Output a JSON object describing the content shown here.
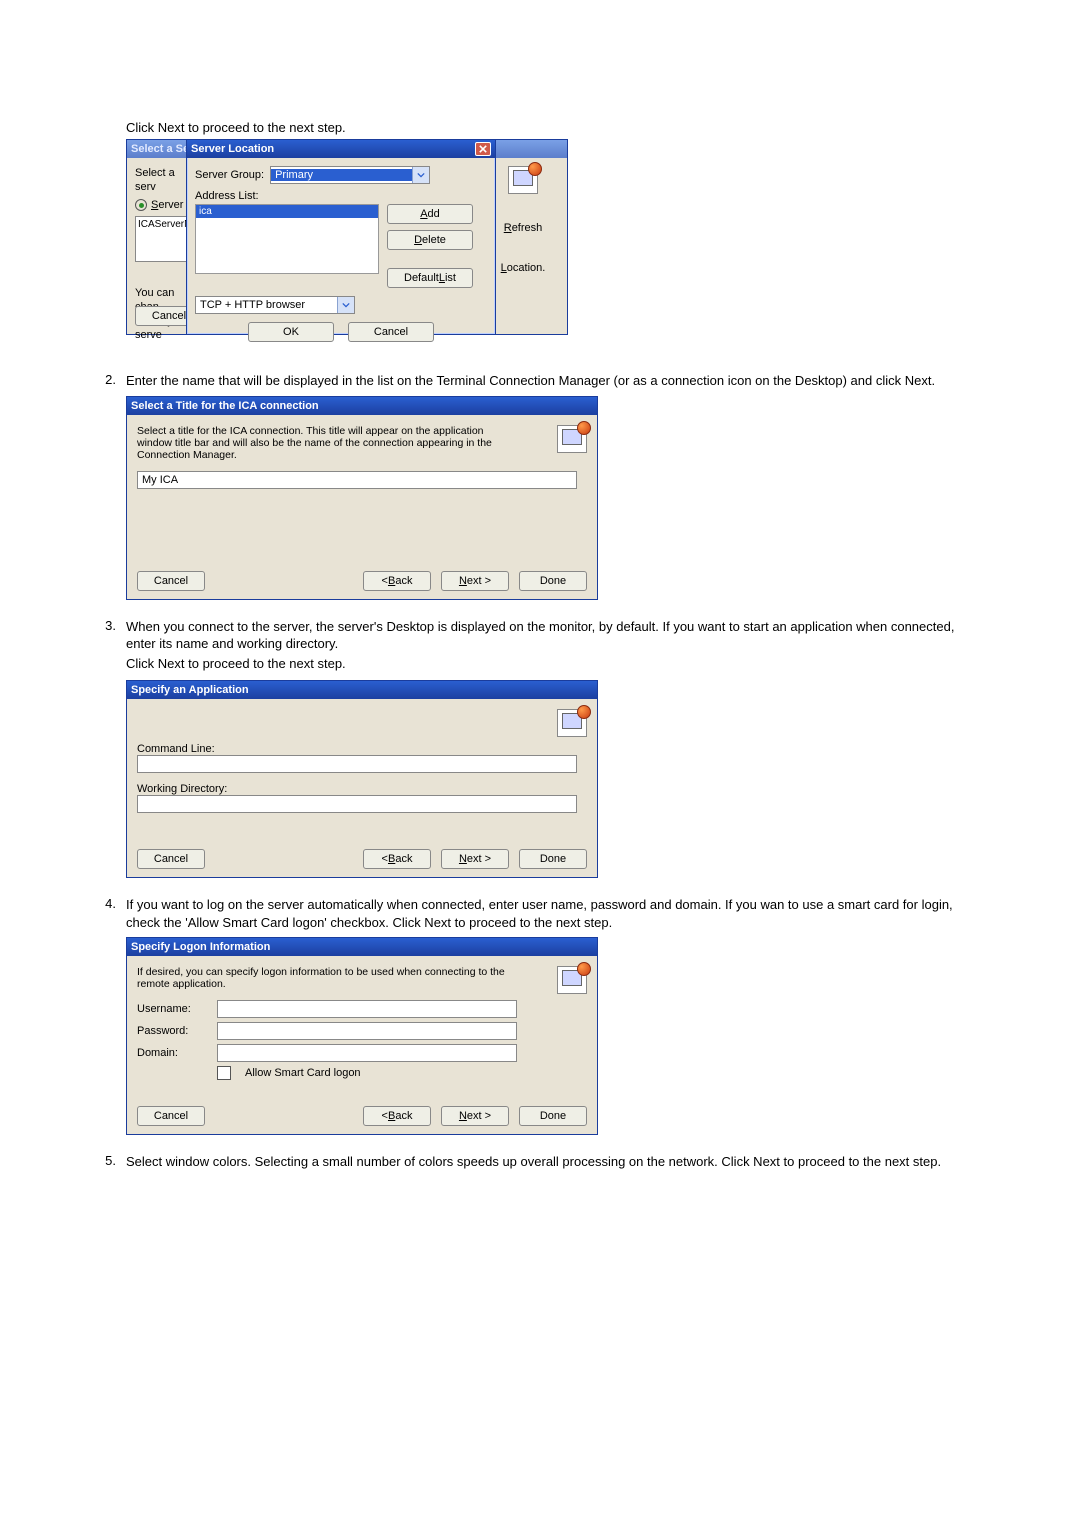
{
  "intro_line": "Click Next to proceed to the next step.",
  "section1": {
    "back": {
      "title": "Select a Serv",
      "radio_server_label": "Server",
      "select_srv_fragment": "Select a serv",
      "list_item": "ICAServerNam",
      "you_can_change_fragment": "You can chan",
      "primary_serve_fragment": "Primary serve",
      "cancel": "Cancel",
      "right_icon_name": "computer-icon",
      "refresh": "Refresh",
      "location": "Location."
    },
    "front": {
      "title": "Server Location",
      "server_group_label": "Server Group:",
      "server_group_value": "Primary",
      "address_list_label": "Address List:",
      "address_list_value": "ica",
      "protocol_value": "TCP + HTTP browser",
      "add": "Add",
      "delete": "Delete",
      "default_list": "Default List",
      "ok": "OK",
      "cancel": "Cancel"
    }
  },
  "step2": {
    "num": "2.",
    "text": "Enter the name that will be displayed in the list on the Terminal Connection Manager (or as a connection icon on the Desktop) and click Next.",
    "dlg": {
      "title": "Select a Title for the ICA connection",
      "desc": "Select a title for the ICA connection. This title will appear on the application window title bar and will also be the name of the connection appearing in the Connection Manager.",
      "value": "My ICA",
      "cancel": "Cancel",
      "back": "< Back",
      "next": "Next >",
      "done": "Done"
    }
  },
  "step3": {
    "num": "3.",
    "text1": "When you connect to the server, the server's Desktop is displayed on the monitor, by default. If you want to start an application when connected, enter its name and working directory.",
    "text2": "Click Next to proceed to the next step.",
    "dlg": {
      "title": "Specify an Application",
      "command_line_label": "Command Line:",
      "working_dir_label": "Working Directory:",
      "cancel": "Cancel",
      "back": "< Back",
      "next": "Next >",
      "done": "Done"
    }
  },
  "step4": {
    "num": "4.",
    "text": "If you want to log on the server automatically when connected, enter user name, password and domain. If you wan to use a smart card for login, check the 'Allow Smart Card logon' checkbox. Click Next to proceed to the next step.",
    "dlg": {
      "title": "Specify Logon Information",
      "desc": "If desired, you can specify logon information to be used when connecting to the remote application.",
      "username_label": "Username:",
      "password_label": "Password:",
      "domain_label": "Domain:",
      "allow_smart": "Allow Smart Card logon",
      "cancel": "Cancel",
      "back": "< Back",
      "next": "Next >",
      "done": "Done"
    }
  },
  "step5": {
    "num": "5.",
    "text": "Select window colors. Selecting a small number of colors speeds up overall processing on the network. Click Next to proceed to the next step."
  }
}
